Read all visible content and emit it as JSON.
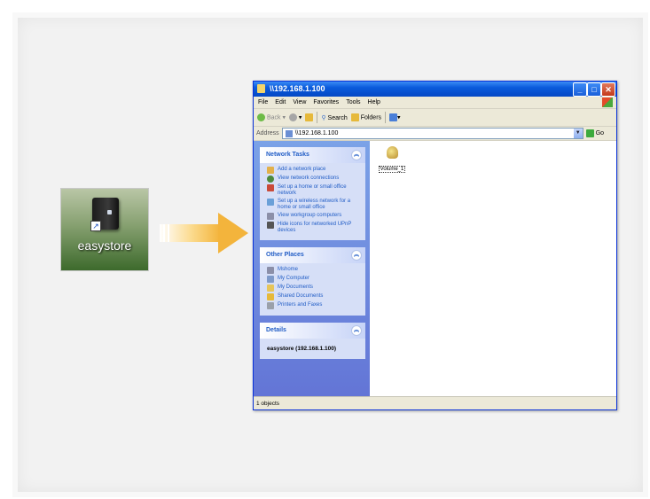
{
  "desktop_icon": {
    "label": "easystore"
  },
  "window": {
    "title": "\\\\192.168.1.100",
    "menu": [
      "File",
      "Edit",
      "View",
      "Favorites",
      "Tools",
      "Help"
    ],
    "toolbar": {
      "back": "Back",
      "search": "Search",
      "folders": "Folders"
    },
    "address": {
      "label": "Address",
      "value": "\\\\192.168.1.100",
      "go": "Go"
    },
    "network_tasks": {
      "title": "Network Tasks",
      "items": [
        "Add a network place",
        "View network connections",
        "Set up a home or small office network",
        "Set up a wireless network for a home or small office",
        "View workgroup computers",
        "Hide icons for networked UPnP devices"
      ]
    },
    "other_places": {
      "title": "Other Places",
      "items": [
        "Mshome",
        "My Computer",
        "My Documents",
        "Shared Documents",
        "Printers and Faxes"
      ]
    },
    "details": {
      "title": "Details",
      "text": "easystore (192.168.1.100)"
    },
    "main_items": [
      {
        "label": "Volume_1"
      }
    ],
    "status": "1 objects"
  }
}
